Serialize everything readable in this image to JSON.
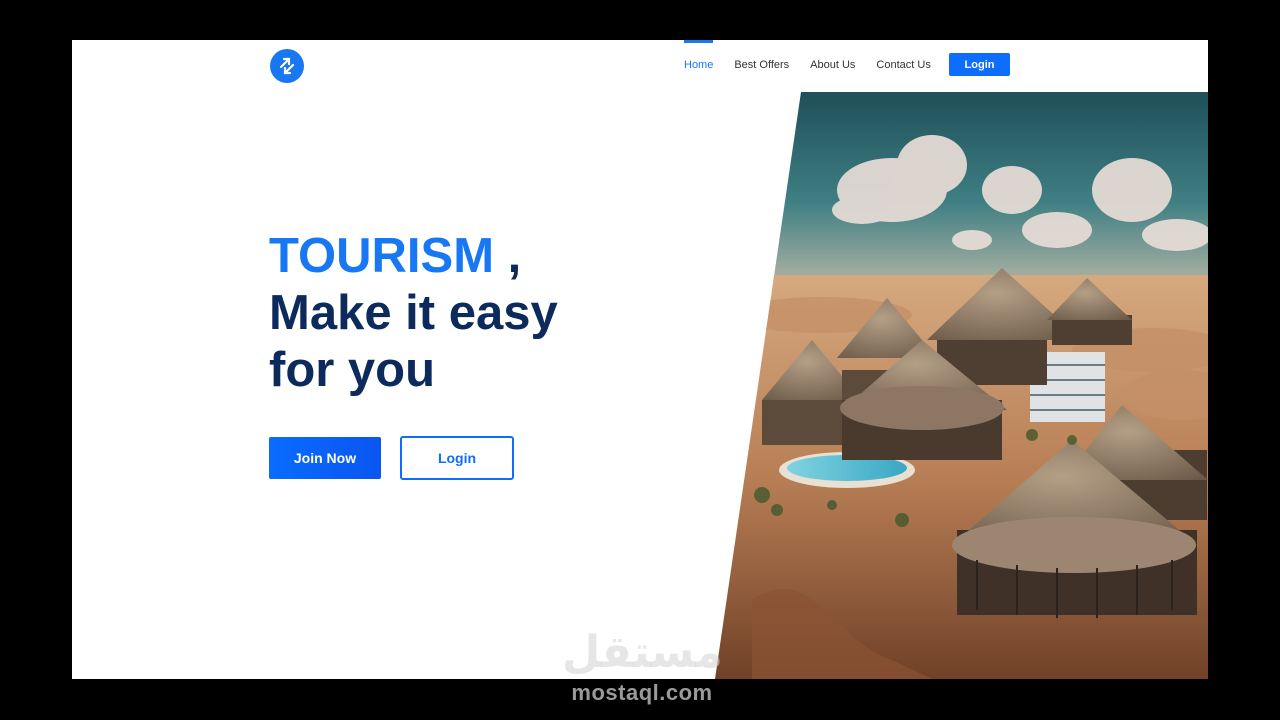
{
  "nav": {
    "items": [
      {
        "label": "Home",
        "active": true
      },
      {
        "label": "Best Offers",
        "active": false
      },
      {
        "label": "About Us",
        "active": false
      },
      {
        "label": "Contact Us",
        "active": false
      }
    ],
    "login_label": "Login"
  },
  "hero": {
    "title_accent": "TOURISM",
    "title_comma": " ,",
    "title_line2": "Make it easy",
    "title_line3": "for you",
    "join_label": "Join Now",
    "login_label": "Login"
  },
  "logo": {
    "icon": "sync-arrows-icon"
  },
  "colors": {
    "accent": "#1877f2",
    "primary_button": "#0d6efd",
    "title_dark": "#0c2a5b"
  },
  "watermark": {
    "arabic": "مستقل",
    "latin": "mostaql.com"
  }
}
